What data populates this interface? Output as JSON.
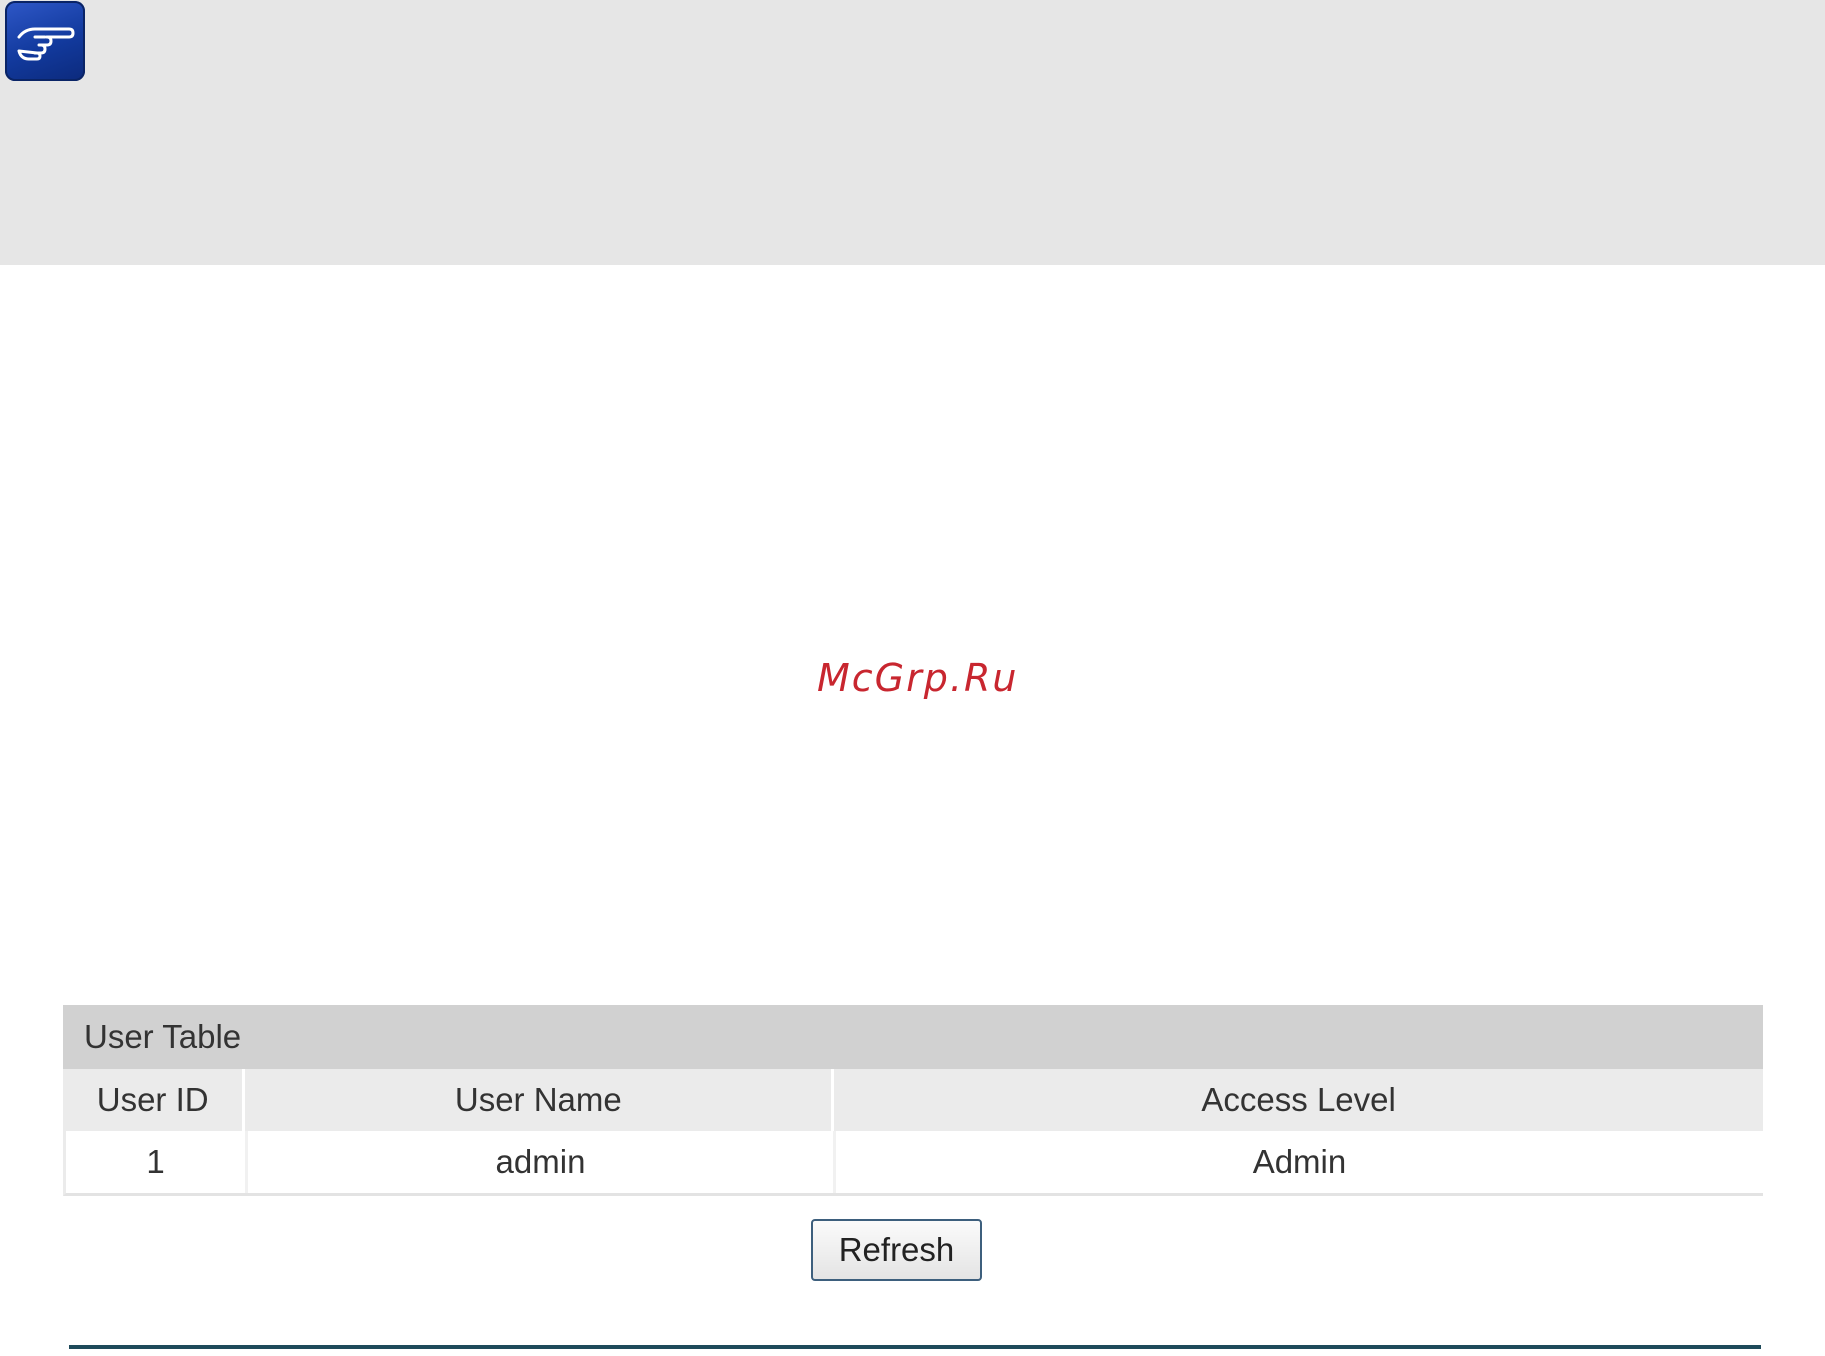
{
  "note": {
    "icon": "pointing-hand-icon",
    "icon_colors": [
      "#2f58c8",
      "#0c2a7c"
    ]
  },
  "watermark": "McGrp.Ru",
  "user_table": {
    "title": "User Table",
    "columns": [
      "User ID",
      "User Name",
      "Access Level"
    ],
    "rows": [
      {
        "user_id": "1",
        "user_name": "admin",
        "access_level": "Admin"
      }
    ]
  },
  "refresh_label": "Refresh"
}
